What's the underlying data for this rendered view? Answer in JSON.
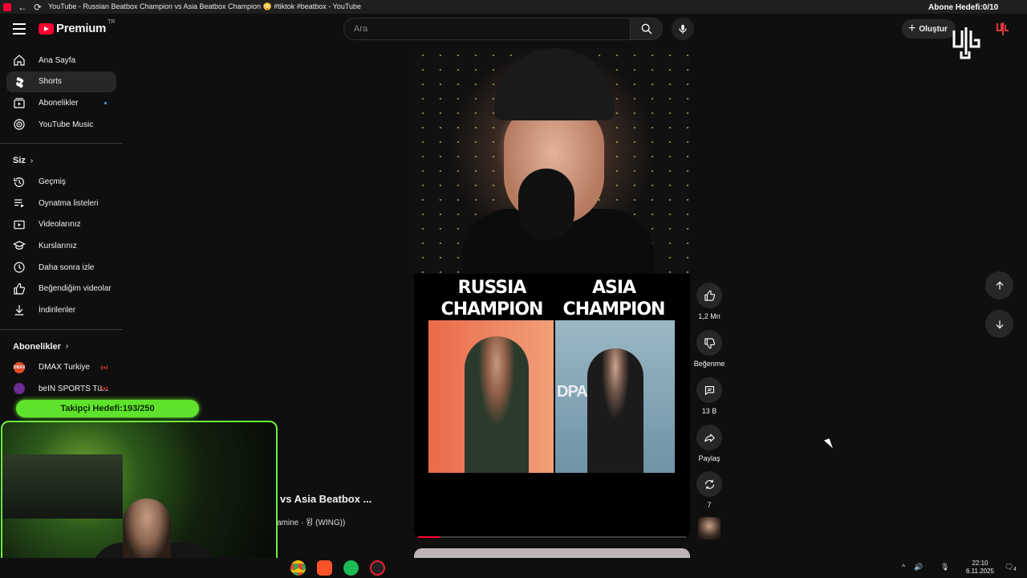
{
  "window": {
    "title": "YouTube - Russian Beatbox Champion vs Asia Beatbox Champion 😳 #tiktok #beatbox - YouTube"
  },
  "masthead": {
    "logo_text": "Premium",
    "region": "TR",
    "search_placeholder": "Ara",
    "create_label": "Oluştur"
  },
  "sidebar": {
    "main": [
      {
        "label": "Ana Sayfa",
        "icon": "home-icon"
      },
      {
        "label": "Shorts",
        "icon": "shorts-icon",
        "active": true
      },
      {
        "label": "Abonelikler",
        "icon": "subscriptions-icon",
        "new_dot": true
      },
      {
        "label": "YouTube Music",
        "icon": "youtube-music-icon"
      }
    ],
    "you_heading": "Siz",
    "you": [
      {
        "label": "Geçmiş",
        "icon": "history-icon"
      },
      {
        "label": "Oynatma listeleri",
        "icon": "playlists-icon"
      },
      {
        "label": "Videolarınız",
        "icon": "your-videos-icon"
      },
      {
        "label": "Kurslarınız",
        "icon": "courses-icon"
      },
      {
        "label": "Daha sonra izle",
        "icon": "watch-later-icon"
      },
      {
        "label": "Beğendiğim videolar",
        "icon": "liked-videos-icon"
      },
      {
        "label": "İndirilenler",
        "icon": "downloads-icon"
      }
    ],
    "subs_heading": "Abonelikler",
    "subscriptions": [
      {
        "label": "DMAX Turkiye",
        "avatar_text": "DMAX",
        "avatar_color": "#e34c2a",
        "live": true
      },
      {
        "label": "beIN SPORTS Tü...",
        "avatar_text": "",
        "avatar_color": "#6a2c91",
        "live": true
      }
    ]
  },
  "stream_overlay": {
    "follower_goal": "Takipçi Hedefi:193/250",
    "subscriber_goal": "Abone Hedefi:0/10"
  },
  "short": {
    "overlay_left": "RUSSIA\nCHAMPION",
    "overlay_right": "ASIA\nCHAMPION",
    "backdrop_text": "DPAMINE",
    "title_partial": "vs Asia Beatbox ...",
    "music_partial": "amine · 윙 (WING))",
    "progress": 0.08
  },
  "actions": {
    "like_count": "1,2 Mn",
    "dislike_label": "Beğenme",
    "comment_count": "13 B",
    "share_label": "Paylaş",
    "remix_count": "7"
  },
  "taskbar": {
    "time": "22:10",
    "date": "6.11.2025",
    "notifications": "4"
  }
}
